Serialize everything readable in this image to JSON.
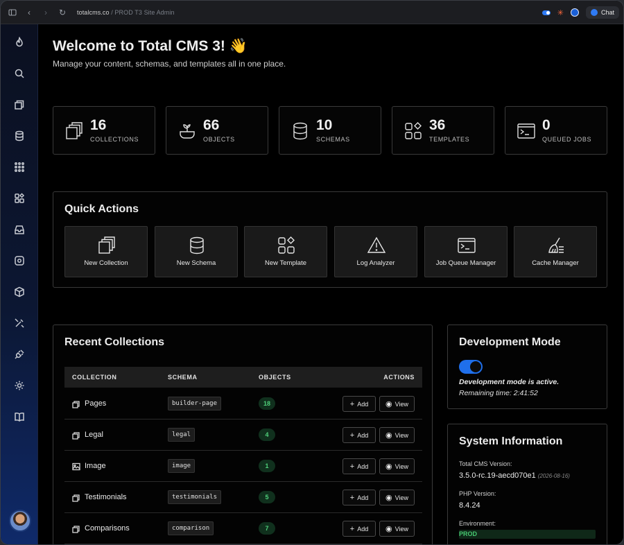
{
  "browser": {
    "url_host": "totalcms.co",
    "url_rest": " / PROD T3 Site Admin",
    "chat_label": "Chat"
  },
  "sidebar": {
    "items": [
      "flame-icon",
      "search-icon",
      "collections-icon",
      "database-icon",
      "grid-dots-icon",
      "templates-icon",
      "inbox-icon",
      "settings-cog-icon",
      "box-icon",
      "tools-icon",
      "plug-icon",
      "gear-icon",
      "book-icon"
    ]
  },
  "header": {
    "title": "Welcome to Total CMS 3! 👋",
    "subtitle": "Manage your content, schemas, and templates all in one place."
  },
  "stats": [
    {
      "value": "16",
      "label": "COLLECTIONS",
      "icon": "collections-icon"
    },
    {
      "value": "66",
      "label": "OBJECTS",
      "icon": "objects-icon"
    },
    {
      "value": "10",
      "label": "SCHEMAS",
      "icon": "database-icon"
    },
    {
      "value": "36",
      "label": "TEMPLATES",
      "icon": "templates-icon"
    },
    {
      "value": "0",
      "label": "QUEUED JOBS",
      "icon": "terminal-icon"
    }
  ],
  "quick_actions": {
    "title": "Quick Actions",
    "items": [
      {
        "label": "New Collection",
        "icon": "collections-icon"
      },
      {
        "label": "New Schema",
        "icon": "database-icon"
      },
      {
        "label": "New Template",
        "icon": "templates-icon"
      },
      {
        "label": "Log Analyzer",
        "icon": "warning-icon"
      },
      {
        "label": "Job Queue Manager",
        "icon": "terminal-icon"
      },
      {
        "label": "Cache Manager",
        "icon": "broom-icon"
      }
    ]
  },
  "recent": {
    "title": "Recent Collections",
    "columns": [
      "COLLECTION",
      "SCHEMA",
      "OBJECTS",
      "ACTIONS"
    ],
    "add_label": "Add",
    "view_label": "View",
    "rows": [
      {
        "name": "Pages",
        "schema": "builder-page",
        "objects": "18",
        "icon": "collection-icon"
      },
      {
        "name": "Legal",
        "schema": "legal",
        "objects": "4",
        "icon": "collection-icon"
      },
      {
        "name": "Image",
        "schema": "image",
        "objects": "1",
        "icon": "image-icon"
      },
      {
        "name": "Testimonials",
        "schema": "testimonials",
        "objects": "5",
        "icon": "collection-icon"
      },
      {
        "name": "Comparisons",
        "schema": "comparison",
        "objects": "7",
        "icon": "collection-icon"
      }
    ]
  },
  "dev_mode": {
    "title": "Development Mode",
    "status": "Development mode is active.",
    "remaining": "Remaining time: 2:41:52",
    "enabled": true
  },
  "system": {
    "title": "System Information",
    "cms_label": "Total CMS Version:",
    "cms_version": "3.5.0-rc.19-aecd070e1",
    "cms_date": "(2026-08-16)",
    "php_label": "PHP Version:",
    "php_version": "8.4.24",
    "env_label": "Environment:",
    "env_value": "PROD"
  },
  "colors": {
    "accent": "#1f6feb",
    "success": "#4fd07a"
  }
}
